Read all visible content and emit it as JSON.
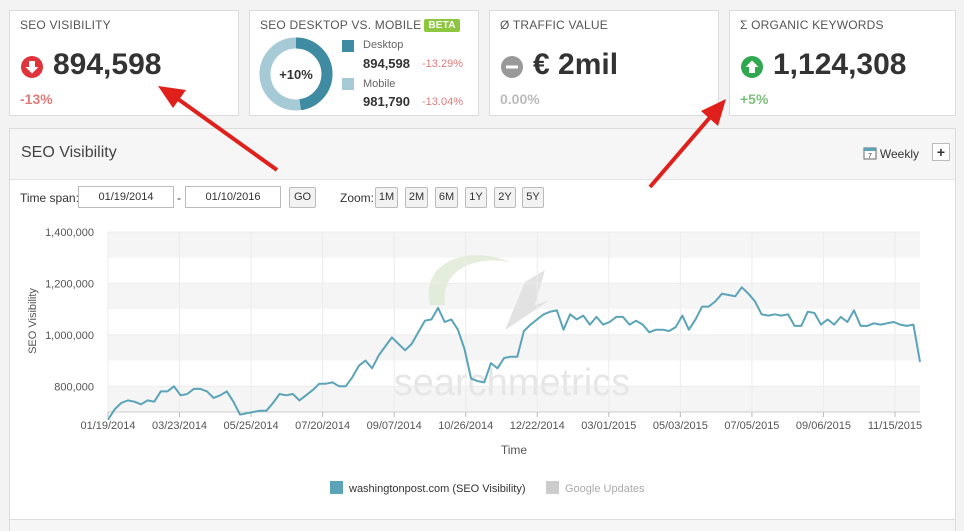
{
  "cards": {
    "visibility": {
      "title": "SEO VISIBILITY",
      "value": "894,598",
      "change": "-13%"
    },
    "desktop_mobile": {
      "title": "SEO DESKTOP VS. MOBILE",
      "badge": "BETA",
      "ring_label": "+10%",
      "desktop_label": "Desktop",
      "desktop_value": "894,598",
      "desktop_change": "-13.29%",
      "mobile_label": "Mobile",
      "mobile_value": "981,790",
      "mobile_change": "-13.04%",
      "desktop_share": 0.477
    },
    "traffic": {
      "title": "Ø TRAFFIC VALUE",
      "value": "€ 2mil",
      "change": "0.00%"
    },
    "keywords": {
      "title": "Σ ORGANIC KEYWORDS",
      "value": "1,124,308",
      "change": "+5%"
    }
  },
  "panel": {
    "title": "SEO Visibility",
    "interval": "Weekly",
    "add": "+",
    "timespan_label": "Time span:",
    "separator": "-",
    "date_from": "01/19/2014",
    "date_to": "01/10/2016",
    "go": "GO",
    "zoom_label": "Zoom:",
    "zoom": [
      "1M",
      "2M",
      "6M",
      "1Y",
      "2Y",
      "5Y"
    ]
  },
  "colors": {
    "series": "#5ba4b8",
    "ring_desktop": "#3f8ba1",
    "ring_mobile": "#a6cbd7",
    "negative": "#e07a7a",
    "positive": "#7cc07c",
    "arrow": "#e0201b"
  },
  "icons": {
    "visibility": "arrow-down-circle-icon",
    "traffic": "minus-circle-icon",
    "keywords": "arrow-up-circle-icon",
    "interval": "calendar-icon"
  },
  "chart_data": {
    "type": "line",
    "title": "",
    "xlabel": "Time",
    "ylabel": "SEO Visibility",
    "ylim": [
      700000,
      1400000
    ],
    "yticks": [
      800000,
      1000000,
      1200000,
      1400000
    ],
    "ytick_labels": [
      "800,000",
      "1,000,000",
      "1,200,000",
      "1,400,000"
    ],
    "xticks": [
      "01/19/2014",
      "03/23/2014",
      "05/25/2014",
      "07/20/2014",
      "09/07/2014",
      "10/26/2014",
      "12/22/2014",
      "03/01/2015",
      "05/03/2015",
      "07/05/2015",
      "09/06/2015",
      "11/15/2015"
    ],
    "watermark": "searchmetrics",
    "grid": true,
    "legend_position": "bottom",
    "series": [
      {
        "name": "washingtonpost.com (SEO Visibility)",
        "values": [
          670000,
          710000,
          735000,
          745000,
          740000,
          730000,
          745000,
          740000,
          780000,
          780000,
          800000,
          765000,
          770000,
          790000,
          790000,
          780000,
          755000,
          765000,
          780000,
          740000,
          690000,
          695000,
          700000,
          705000,
          705000,
          735000,
          770000,
          765000,
          770000,
          745000,
          765000,
          785000,
          810000,
          810000,
          815000,
          800000,
          800000,
          835000,
          880000,
          900000,
          870000,
          920000,
          955000,
          990000,
          965000,
          940000,
          965000,
          1010000,
          1055000,
          1060000,
          1105000,
          1050000,
          1060000,
          1020000,
          945000,
          830000,
          820000,
          815000,
          890000,
          870000,
          910000,
          915000,
          915000,
          1015000,
          1040000,
          1060000,
          1080000,
          1090000,
          1095000,
          1020000,
          1080000,
          1060000,
          1075000,
          1040000,
          1070000,
          1040000,
          1050000,
          1070000,
          1070000,
          1040000,
          1055000,
          1040000,
          1010000,
          1020000,
          1020000,
          1015000,
          1030000,
          1075000,
          1020000,
          1060000,
          1110000,
          1110000,
          1130000,
          1160000,
          1155000,
          1150000,
          1185000,
          1160000,
          1130000,
          1080000,
          1075000,
          1080000,
          1075000,
          1080000,
          1035000,
          1035000,
          1090000,
          1085000,
          1040000,
          1060000,
          1040000,
          1070000,
          1050000,
          1095000,
          1035000,
          1035000,
          1045000,
          1040000,
          1045000,
          1050000,
          1040000,
          1035000,
          1040000,
          895000
        ]
      }
    ],
    "legend": [
      {
        "label": "washingtonpost.com (SEO Visibility)",
        "color": "#5ba4b8"
      },
      {
        "label": "Google Updates",
        "color": "#cccccc"
      }
    ]
  }
}
